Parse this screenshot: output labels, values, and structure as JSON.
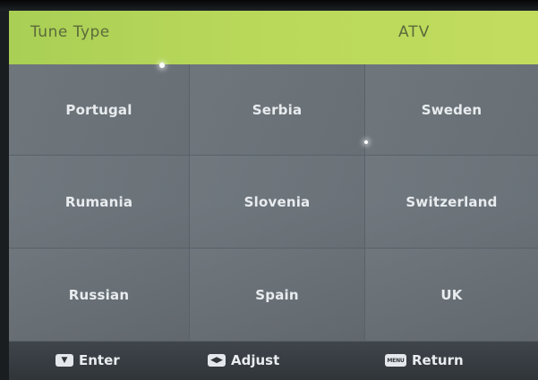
{
  "header": {
    "label": "Tune Type",
    "value": "ATV"
  },
  "countries": [
    "Portugal",
    "Serbia",
    "Sweden",
    "Rumania",
    "Slovenia",
    "Switzerland",
    "Russian",
    "Spain",
    "UK"
  ],
  "footer": {
    "enter": {
      "icon": "down-arrow-key-icon",
      "label": "Enter"
    },
    "adjust": {
      "icon": "left-right-arrows-key-icon",
      "label": "Adjust"
    },
    "return": {
      "icon": "menu-key-icon",
      "label": "Return",
      "key_text": "MENU"
    }
  },
  "colors": {
    "header_bg": "#b9d85a",
    "header_text": "#5b6a3b",
    "grid_bg": "#6d757c",
    "footer_bg": "#3a4045",
    "cell_text": "#e8ecef"
  }
}
